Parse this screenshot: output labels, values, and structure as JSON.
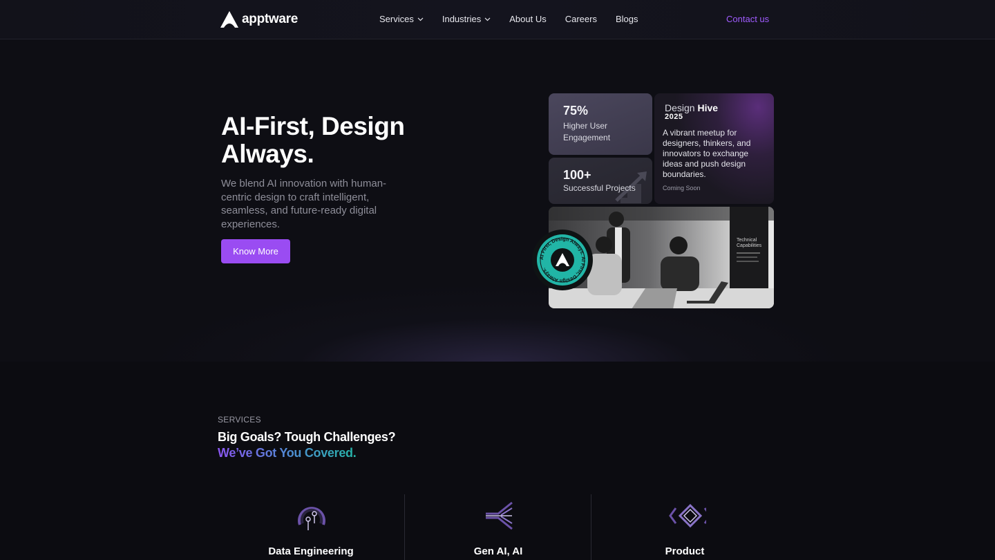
{
  "header": {
    "logo_text": "apptware",
    "nav": [
      {
        "label": "Services",
        "dropdown": true
      },
      {
        "label": "Industries",
        "dropdown": true
      },
      {
        "label": "About Us",
        "dropdown": false
      },
      {
        "label": "Careers",
        "dropdown": false
      },
      {
        "label": "Blogs",
        "dropdown": false
      }
    ],
    "contact_label": "Contact us"
  },
  "hero": {
    "title": "AI-First, Design Always.",
    "subtitle": "We blend AI innovation with human-centric design to craft intelligent, seamless, and future-ready digital experiences.",
    "cta_label": "Know More",
    "stats": [
      {
        "value": "75%",
        "label": "Higher User Engagement"
      },
      {
        "value": "100+",
        "label": "Successful Projects"
      }
    ],
    "event": {
      "title_light": "Design",
      "title_bold": "Hive",
      "year": "2025",
      "description": "A vibrant meetup for designers, thinkers, and innovators to exchange ideas and push design boundaries.",
      "status": "Coming Soon"
    },
    "photo": {
      "screen_title": "Technical Capabilities"
    },
    "badge_text": "AI First, Design Always. AI First, Design Always."
  },
  "services": {
    "tag": "SERVICES",
    "heading_line1": "Big Goals? Tough Challenges?",
    "heading_line2": "We’ve Got You Covered.",
    "items": [
      {
        "name": "Data Engineering",
        "icon": "data-engineering-icon"
      },
      {
        "name": "Gen AI, AI",
        "icon": "gen-ai-icon"
      },
      {
        "name": "Product",
        "icon": "product-icon"
      }
    ]
  },
  "colors": {
    "accent": "#9a4cf2",
    "contact": "#a05cff",
    "teal": "#21b5a6",
    "background": "#0c0c11"
  }
}
